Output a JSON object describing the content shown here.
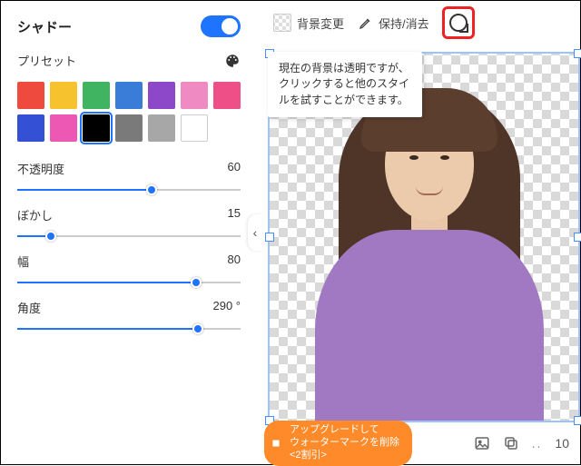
{
  "panel": {
    "title": "シャドー",
    "toggle_on": true,
    "preset_label": "プリセット",
    "swatches": [
      {
        "c": "#ee4b3e"
      },
      {
        "c": "#f6c22e"
      },
      {
        "c": "#40b460"
      },
      {
        "c": "#3a7dd8"
      },
      {
        "c": "#8c48c9"
      },
      {
        "c": "#f08ac2"
      },
      {
        "c": "#ed4f86"
      },
      {
        "c": "#3450d4"
      },
      {
        "c": "#ee58b5"
      },
      {
        "c": "#000000",
        "sel": true
      },
      {
        "c": "#7a7a7a"
      },
      {
        "c": "#a7a7a7"
      },
      {
        "c": "#ffffff",
        "empty": true
      }
    ],
    "sliders": [
      {
        "label": "不透明度",
        "value": "60",
        "pct": 60
      },
      {
        "label": "ぼかし",
        "value": "15",
        "pct": 15
      },
      {
        "label": "幅",
        "value": "80",
        "pct": 80
      },
      {
        "label": "角度",
        "value": "290 °",
        "pct": 81
      }
    ]
  },
  "topbar": {
    "bg_change": "背景変更",
    "keep_erase": "保持/消去"
  },
  "tooltip": "現在の背景は透明ですが、クリックすると他のスタイルを試すことができます。",
  "upgrade": {
    "line1": "アップグレードして",
    "line2": "ウォーターマークを削除",
    "line3": "<2割引>"
  },
  "zoom": "10"
}
